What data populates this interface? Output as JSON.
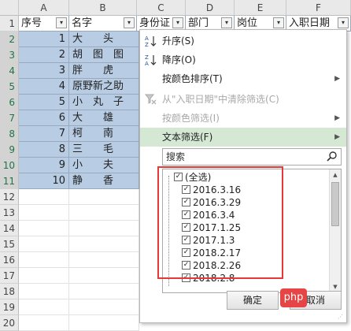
{
  "columns": [
    "A",
    "B",
    "C",
    "D",
    "E",
    "F"
  ],
  "rows": [
    "1",
    "2",
    "3",
    "4",
    "5",
    "6",
    "7",
    "8",
    "9",
    "10",
    "11",
    "12",
    "13",
    "14",
    "15",
    "16",
    "17",
    "18",
    "19",
    "20"
  ],
  "headers": {
    "a": "序号",
    "b": "名字",
    "c": "身份证",
    "d": "部门",
    "e": "岗位",
    "f": "入职日期"
  },
  "data_rows": [
    {
      "no": "1",
      "name": "大　　头"
    },
    {
      "no": "2",
      "name": "胡　图　图"
    },
    {
      "no": "3",
      "name": "胖　　虎"
    },
    {
      "no": "4",
      "name": "原野新之助"
    },
    {
      "no": "5",
      "name": "小　丸　子"
    },
    {
      "no": "6",
      "name": "大　　雄"
    },
    {
      "no": "7",
      "name": "柯　　南"
    },
    {
      "no": "8",
      "name": "三　　毛"
    },
    {
      "no": "9",
      "name": "小　　夫"
    },
    {
      "no": "10",
      "name": "静　　香"
    }
  ],
  "menu": {
    "sort_asc": "升序(S)",
    "sort_desc": "降序(O)",
    "sort_by_color": "按颜色排序(T)",
    "clear_filter": "从\"入职日期\"中清除筛选(C)",
    "filter_by_color": "按颜色筛选(I)",
    "text_filter": "文本筛选(F)",
    "search_placeholder": "搜索",
    "items": [
      {
        "label": "(全选)",
        "checked": true
      },
      {
        "label": "2016.3.16",
        "checked": true
      },
      {
        "label": "2016.3.29",
        "checked": true
      },
      {
        "label": "2016.3.4",
        "checked": true
      },
      {
        "label": "2017.1.25",
        "checked": true
      },
      {
        "label": "2017.1.3",
        "checked": true
      },
      {
        "label": "2018.2.17",
        "checked": true
      },
      {
        "label": "2018.2.26",
        "checked": true
      },
      {
        "label": "2018.2.8",
        "checked": true
      }
    ],
    "ok": "确定",
    "cancel": "取消"
  },
  "watermark": "php",
  "colors": {
    "selected_fill": "#b8cce4",
    "highlight": "#d5e8d4",
    "red_outline": "#e53935"
  }
}
